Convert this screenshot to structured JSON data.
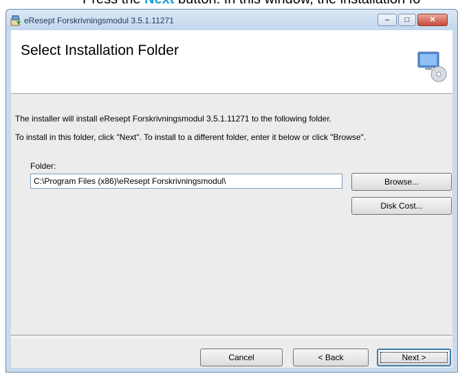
{
  "caption": {
    "prefix": "Press the ",
    "highlight": "Next",
    "suffix": " button. In this window, the installation fo"
  },
  "window": {
    "title": "eResept Forskrivningsmodul 3.5.1.11271",
    "controls": {
      "minimize": "–",
      "maximize": "□",
      "close": "✕"
    }
  },
  "banner": {
    "title": "Select Installation Folder"
  },
  "body": {
    "line1": "The installer will install eResept Forskrivningsmodul 3.5.1.11271 to the following folder.",
    "line2": "To install in this folder, click \"Next\". To install to a different folder, enter it below or click \"Browse\".",
    "folder_label": "Folder:",
    "folder_value": "C:\\Program Files (x86)\\eResept Forskrivningsmodul\\"
  },
  "buttons": {
    "browse": "Browse...",
    "disk_cost": "Disk Cost...",
    "cancel": "Cancel",
    "back": "< Back",
    "next": "Next >"
  },
  "colors": {
    "caption_highlight": "#1a9fd0",
    "titlebar": "#c3d6ec",
    "close_button": "#c7493a"
  }
}
